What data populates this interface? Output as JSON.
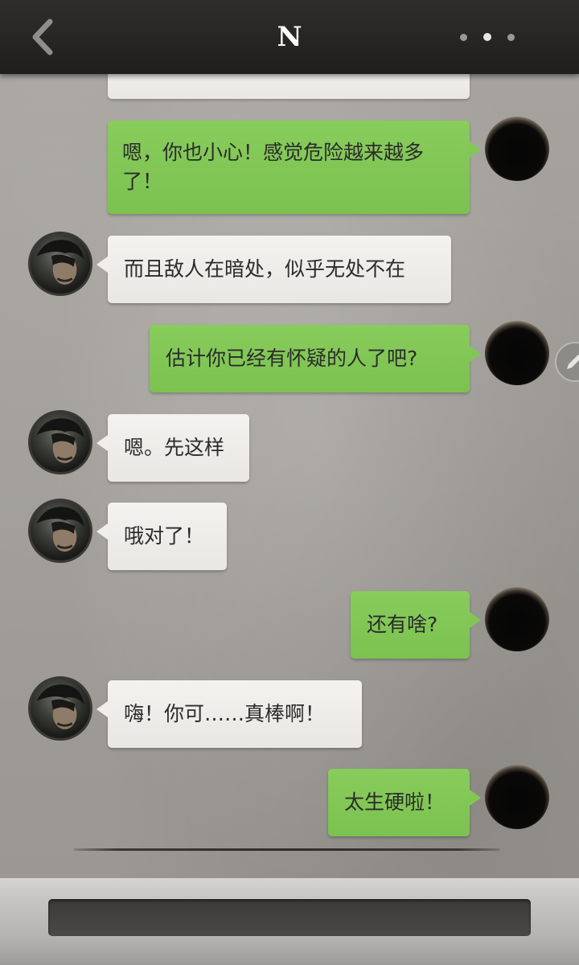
{
  "header": {
    "title": "N",
    "back_icon": "chevron-left-icon",
    "more_icon": "more-dots-icon"
  },
  "messages": [
    {
      "side": "right",
      "text": "嗯，你也小心！感觉危险越来越多了！"
    },
    {
      "side": "left",
      "text": "而且敌人在暗处，似乎无处不在"
    },
    {
      "side": "right",
      "text": "估计你已经有怀疑的人了吧?"
    },
    {
      "side": "left",
      "text": "嗯。先这样"
    },
    {
      "side": "left",
      "text": "哦对了！"
    },
    {
      "side": "right",
      "text": "还有啥?"
    },
    {
      "side": "left",
      "text": "嗨！你可……真棒啊！"
    },
    {
      "side": "right",
      "text": "太生硬啦！"
    }
  ],
  "floating": {
    "edit_icon": "pencil-icon"
  },
  "footer": {
    "input_value": ""
  },
  "colors": {
    "header_bg": "#2a2928",
    "self_bubble": "#84c858",
    "other_bubble": "#efeeeb",
    "background": "#a19e99"
  }
}
